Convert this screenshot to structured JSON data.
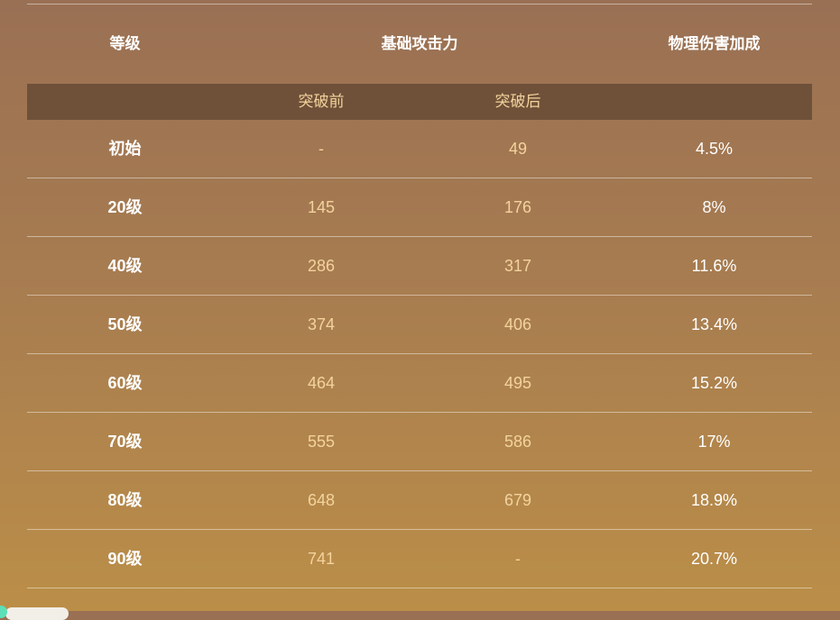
{
  "header": {
    "level": "等级",
    "base_attack": "基础攻击力",
    "physical_bonus": "物理伤害加成"
  },
  "subheader": {
    "before": "突破前",
    "after": "突破后"
  },
  "rows": [
    {
      "level": "初始",
      "before": "-",
      "after": "49",
      "phys": "4.5%"
    },
    {
      "level": "20级",
      "before": "145",
      "after": "176",
      "phys": "8%"
    },
    {
      "level": "40级",
      "before": "286",
      "after": "317",
      "phys": "11.6%"
    },
    {
      "level": "50级",
      "before": "374",
      "after": "406",
      "phys": "13.4%"
    },
    {
      "level": "60级",
      "before": "464",
      "after": "495",
      "phys": "15.2%"
    },
    {
      "level": "70级",
      "before": "555",
      "after": "586",
      "phys": "17%"
    },
    {
      "level": "80级",
      "before": "648",
      "after": "679",
      "phys": "18.9%"
    },
    {
      "level": "90级",
      "before": "741",
      "after": "-",
      "phys": "20.7%"
    }
  ]
}
